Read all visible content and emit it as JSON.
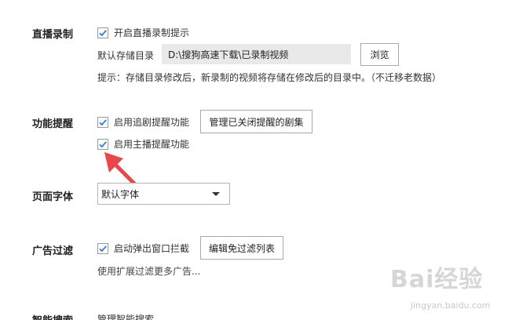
{
  "live_recording": {
    "section_label": "直播录制",
    "enable_prompt_label": "开启直播录制提示",
    "enable_prompt_checked": true,
    "storage_dir_label": "默认存储目录",
    "storage_dir_value": "D:\\搜狗高速下载\\已录制视频",
    "browse_label": "浏览",
    "hint": "提示：存储目录修改后，新录制的视频将存储在修改后的目录中。（不迁移老数据）"
  },
  "reminders": {
    "section_label": "功能提醒",
    "follow_reminder_label": "启用追剧提醒功能",
    "follow_reminder_checked": true,
    "manage_closed_label": "管理已关闭提醒的剧集",
    "host_reminder_label": "启用主播提醒功能",
    "host_reminder_checked": true
  },
  "page_font": {
    "section_label": "页面字体",
    "selected": "默认字体"
  },
  "ad_filter": {
    "section_label": "广告过滤",
    "popup_block_label": "启动弹出窗口拦截",
    "popup_block_checked": true,
    "edit_exempt_label": "编辑免过滤列表",
    "more_ads_link": "使用扩展过滤更多广告..."
  },
  "smart_search": {
    "section_label": "智能搜索",
    "manage_label": "管理智能搜索"
  },
  "watermark": {
    "brand": "Bai经验",
    "url": "jingyan.baidu.com"
  },
  "colors": {
    "check_blue": "#2f7fd6",
    "arrow_red": "#e8474b"
  }
}
